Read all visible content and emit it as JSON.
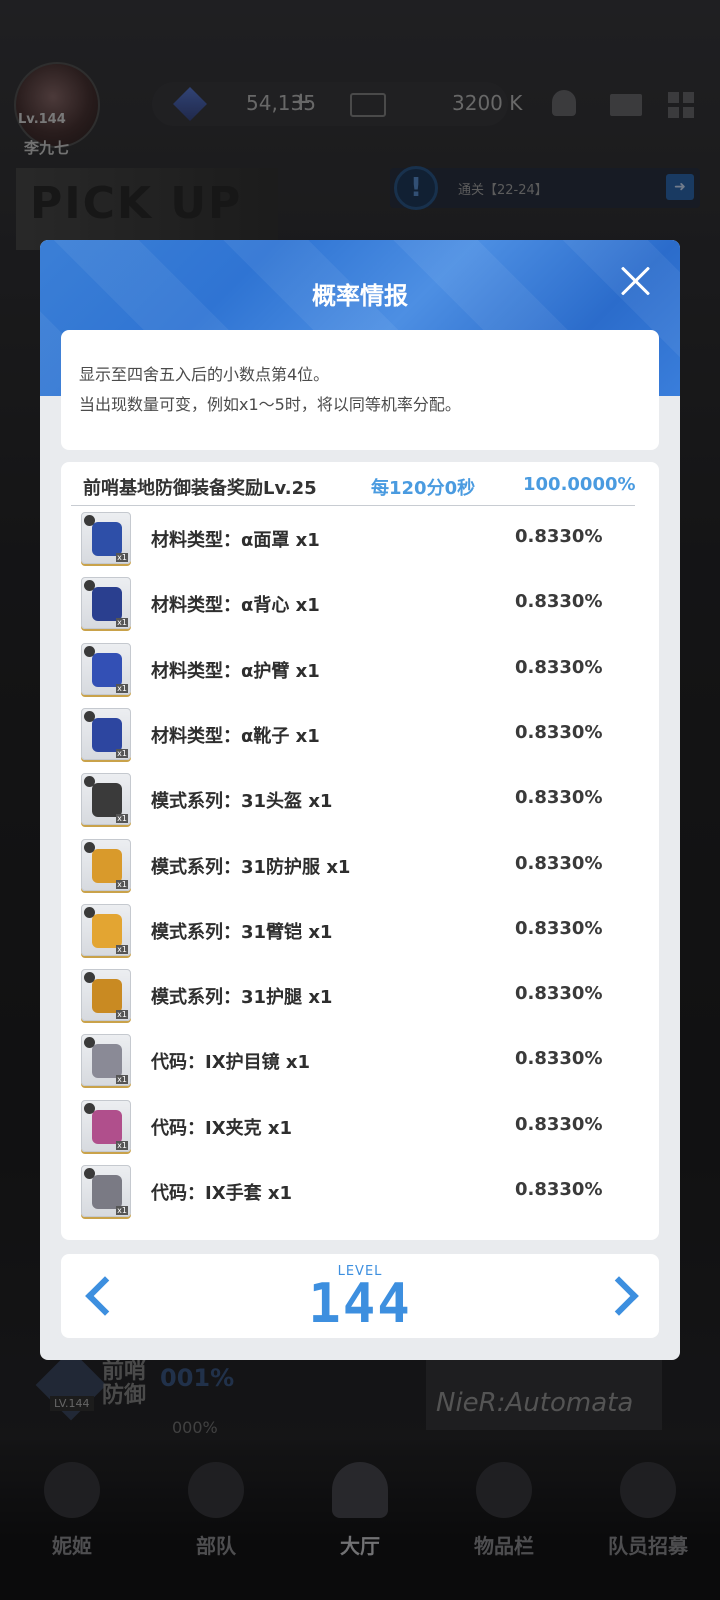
{
  "hud": {
    "player_level_text": "Lv.144",
    "player_name": "李九七",
    "gems": "54,135",
    "gems_plus": "+",
    "credits": "3200 K",
    "mission_text": "通关【22-24】",
    "pickup_text": "PICK UP"
  },
  "background": {
    "frontline_label": "前哨防御",
    "percent_text": "001%",
    "percent_small": "000%",
    "level_badge": "LV.144",
    "collab_text": "NieR:Automata"
  },
  "bottom_nav": {
    "items": [
      {
        "label": "妮姬"
      },
      {
        "label": "部队"
      },
      {
        "label": "大厅"
      },
      {
        "label": "物品栏"
      },
      {
        "label": "队员招募"
      }
    ]
  },
  "modal": {
    "title": "概率情报",
    "notice": [
      "显示至四舍五入后的小数点第4位。",
      "当出现数量可变，例如x1～5时，将以同等机率分配。"
    ],
    "group": {
      "name": "前哨基地防御装备奖励Lv.25",
      "interval": "每120分0秒",
      "rate": "100.0000%"
    },
    "items": [
      {
        "name": "材料类型：α面罩 x1",
        "rate": "0.8330%",
        "color": "#2e4fa8"
      },
      {
        "name": "材料类型：α背心 x1",
        "rate": "0.8330%",
        "color": "#2a3f8f"
      },
      {
        "name": "材料类型：α护臂 x1",
        "rate": "0.8330%",
        "color": "#3350b5"
      },
      {
        "name": "材料类型：α靴子 x1",
        "rate": "0.8330%",
        "color": "#2d46a0"
      },
      {
        "name": "模式系列：31头盔 x1",
        "rate": "0.8330%",
        "color": "#3a3a3a"
      },
      {
        "name": "模式系列：31防护服 x1",
        "rate": "0.8330%",
        "color": "#d99a2b"
      },
      {
        "name": "模式系列：31臂铠 x1",
        "rate": "0.8330%",
        "color": "#e3a532"
      },
      {
        "name": "模式系列：31护腿 x1",
        "rate": "0.8330%",
        "color": "#c98a22"
      },
      {
        "name": "代码：IX护目镜 x1",
        "rate": "0.8330%",
        "color": "#8a8a96"
      },
      {
        "name": "代码：IX夹克 x1",
        "rate": "0.8330%",
        "color": "#b04f8c"
      },
      {
        "name": "代码：IX手套 x1",
        "rate": "0.8330%",
        "color": "#7a7a84"
      }
    ],
    "level": {
      "caption": "LEVEL",
      "value": "144"
    }
  }
}
